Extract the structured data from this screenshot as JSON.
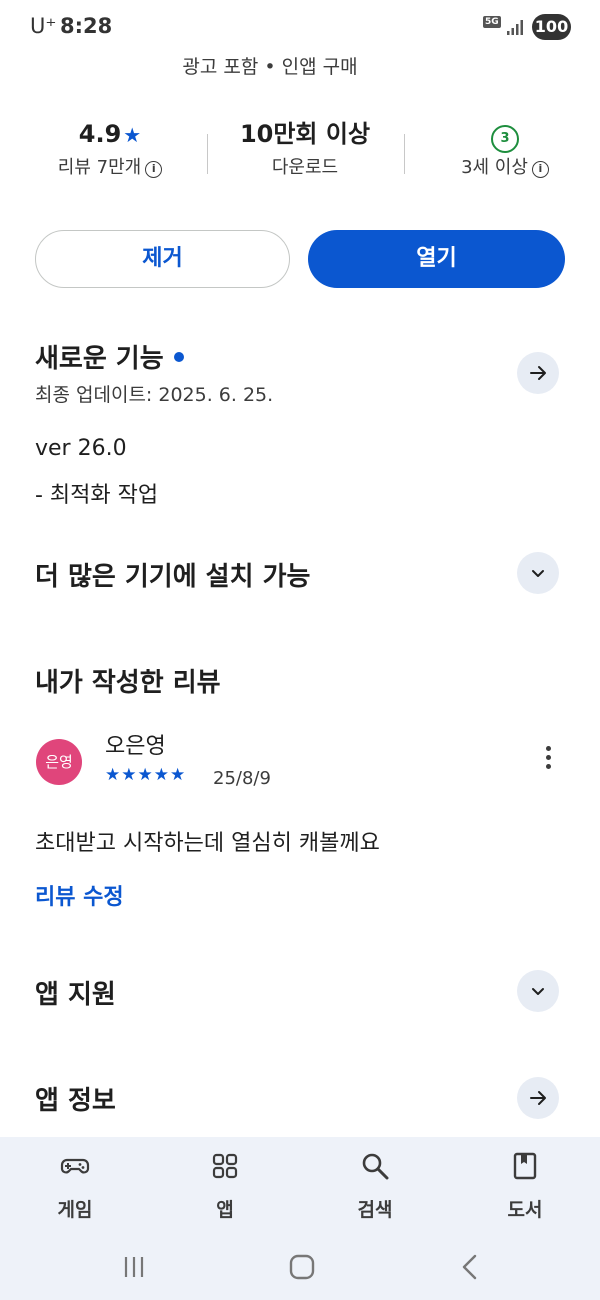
{
  "status_bar": {
    "carrier": "U⁺",
    "time": "8:28",
    "network": "5G",
    "battery": "100"
  },
  "meta_line": "광고 포함  •  인앱 구매",
  "stats": {
    "rating_value": "4.9",
    "rating_star": "★",
    "rating_label": "리뷰 7만개",
    "downloads_value": "10만회 이상",
    "downloads_label": "다운로드",
    "age_badge": "3",
    "age_label": "3세 이상"
  },
  "buttons": {
    "remove": "제거",
    "open": "열기"
  },
  "whats_new": {
    "title": "새로운 기능",
    "updated": "최종 업데이트: 2025. 6. 25.",
    "version": "ver 26.0",
    "note": "- 최적화 작업"
  },
  "more_devices": {
    "title": "더 많은 기기에 설치 가능"
  },
  "my_review": {
    "title": "내가 작성한 리뷰",
    "avatar_text": "은영",
    "reviewer": "오은영",
    "stars": "★★★★★",
    "rating": 5,
    "date": "25/8/9",
    "text": "초대받고 시작하는데 열심히 캐볼께요",
    "edit_label": "리뷰 수정"
  },
  "app_support": {
    "title": "앱 지원"
  },
  "app_info": {
    "title": "앱 정보"
  },
  "bottom_nav": {
    "items": [
      {
        "label": "게임",
        "icon": "gamepad-icon"
      },
      {
        "label": "앱",
        "icon": "apps-grid-icon"
      },
      {
        "label": "검색",
        "icon": "search-icon"
      },
      {
        "label": "도서",
        "icon": "book-icon"
      }
    ]
  },
  "colors": {
    "accent": "#0b57d0",
    "age_green": "#1e8e3e",
    "avatar": "#e0457b",
    "nav_bg": "#eef2f9"
  }
}
